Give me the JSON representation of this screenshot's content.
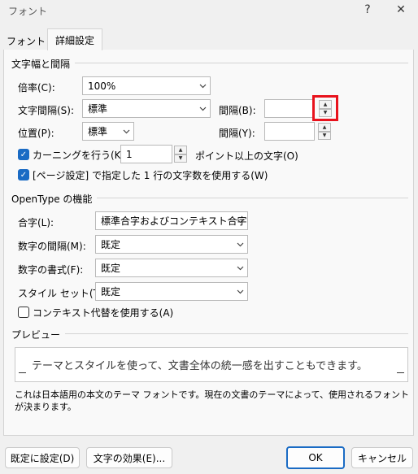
{
  "window": {
    "title": "フォント",
    "help": "?",
    "close": "✕"
  },
  "tabs": [
    {
      "label": "フォント"
    },
    {
      "label": "詳細設定"
    }
  ],
  "char_spacing": {
    "title": "文字幅と間隔",
    "scale_label": "倍率(C):",
    "scale_value": "100%",
    "spacing_label": "文字間隔(S):",
    "spacing_value": "標準",
    "spacing_by_label": "間隔(B):",
    "spacing_by_value": "",
    "position_label": "位置(P):",
    "position_value": "標準",
    "position_by_label": "間隔(Y):",
    "position_by_value": "",
    "kerning_label": "カーニングを行う(K):",
    "kerning_value": "1",
    "kerning_suffix": "ポイント以上の文字(O)",
    "grid_label": "[ページ設定] で指定した 1 行の文字数を使用する(W)"
  },
  "opentype": {
    "title": "OpenType の機能",
    "ligatures_label": "合字(L):",
    "ligatures_value": "標準合字およびコンテキスト合字",
    "num_spacing_label": "数字の間隔(M):",
    "num_spacing_value": "既定",
    "num_forms_label": "数字の書式(F):",
    "num_forms_value": "既定",
    "stylistic_label": "スタイル セット(T):",
    "stylistic_value": "既定",
    "contextual_label": "コンテキスト代替を使用する(A)"
  },
  "preview": {
    "title": "プレビュー",
    "text": "テーマとスタイルを使って、文書全体の統一感を出すこともできます。",
    "note": "これは日本語用の本文のテーマ フォントです。現在の文書のテーマによって、使用されるフォントが決まります。"
  },
  "buttons": {
    "default": "既定に設定(D)",
    "effects": "文字の効果(E)...",
    "ok": "OK",
    "cancel": "キャンセル"
  }
}
